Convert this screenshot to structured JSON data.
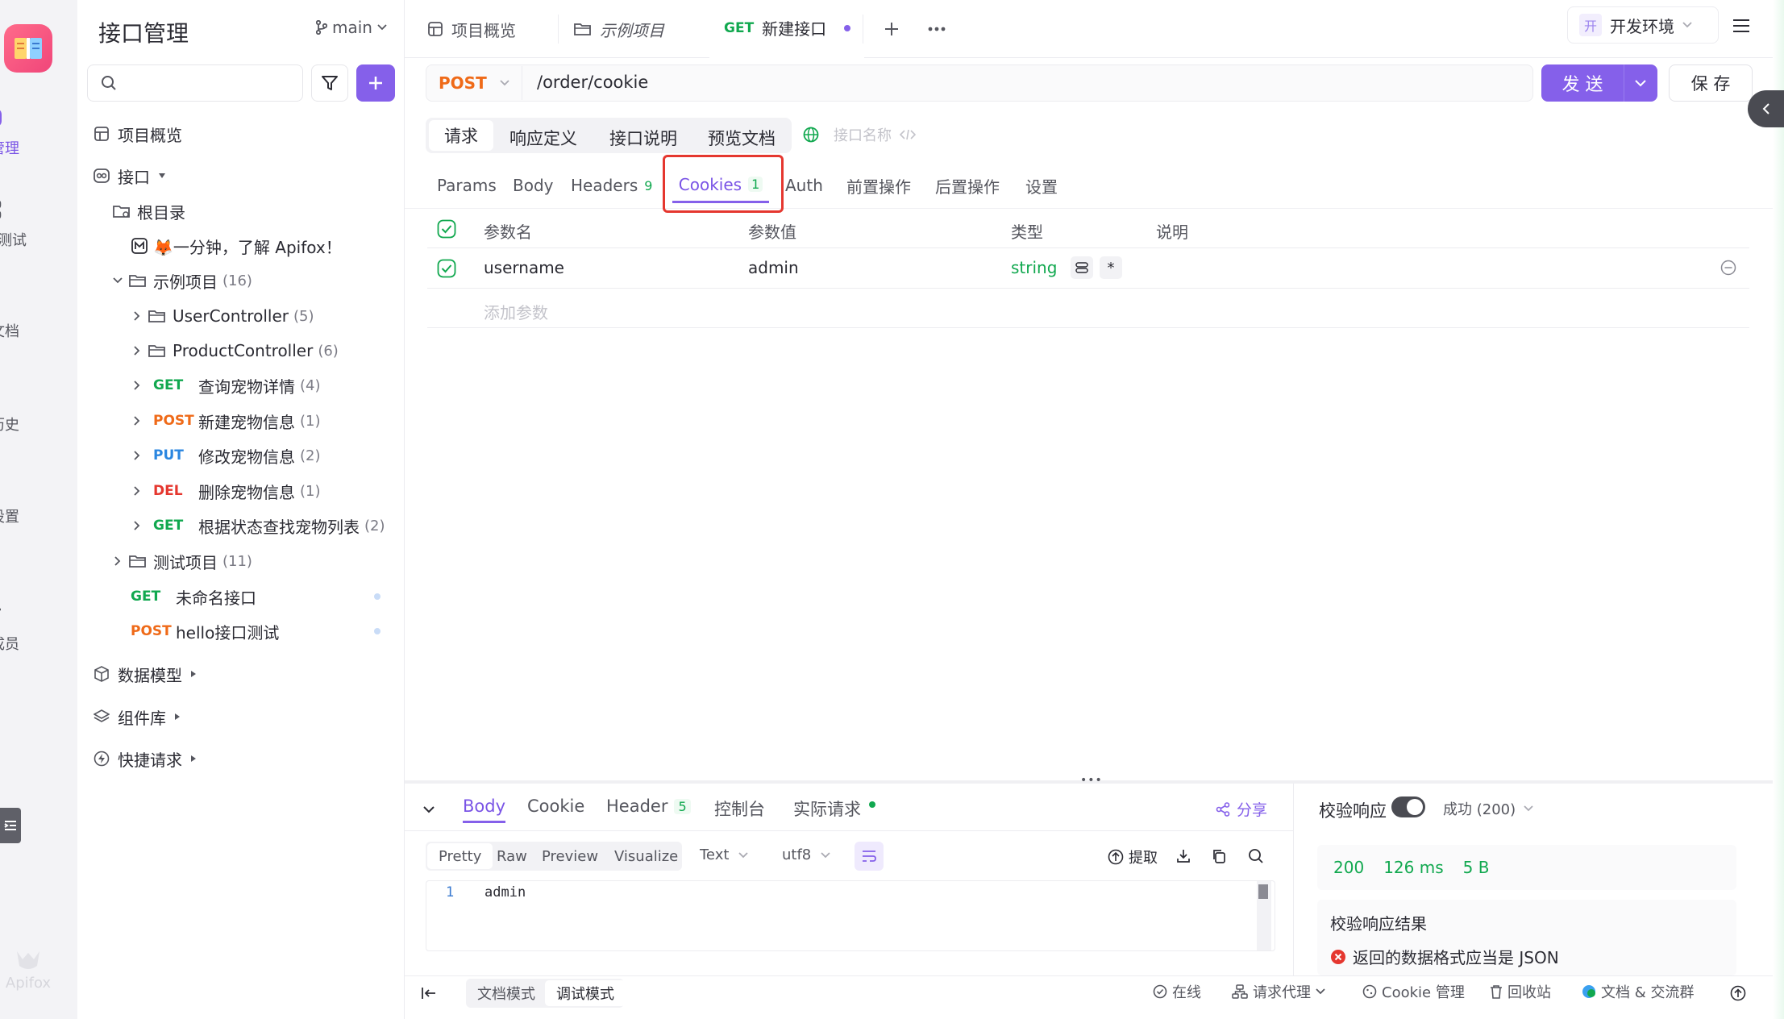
{
  "colors": {
    "accent": "#8560ea",
    "get": "#11a84f",
    "post": "#ef6a18",
    "put": "#2a86e0",
    "del": "#e5372f",
    "highlight": "#e5372f"
  },
  "rail": {
    "items": [
      {
        "label": "接口管理",
        "icon": "api-icon"
      },
      {
        "label": "自动化测试",
        "icon": "automation-icon"
      },
      {
        "label": "分享文档",
        "icon": "book-icon"
      },
      {
        "label": "请求历史",
        "icon": "clock-icon"
      },
      {
        "label": "项目设置",
        "icon": "gear-icon"
      },
      {
        "label": "邀请成员",
        "icon": "add-user-icon"
      }
    ],
    "brand": "Apifox"
  },
  "sidebar": {
    "title": "接口管理",
    "branch": "main",
    "search_placeholder": "",
    "overview": "项目概览",
    "api_section": "接口",
    "root": "根目录",
    "intro_doc": "🦊一分钟，了解 Apifox！",
    "folder_sample": {
      "name": "示例项目",
      "count": "(16)"
    },
    "tree": [
      {
        "kind": "folder",
        "name": "UserController",
        "count": "(5)"
      },
      {
        "kind": "folder",
        "name": "ProductController",
        "count": "(6)"
      },
      {
        "kind": "api",
        "method": "GET",
        "name": "查询宠物详情",
        "count": "(4)"
      },
      {
        "kind": "api",
        "method": "POST",
        "name": "新建宠物信息",
        "count": "(1)"
      },
      {
        "kind": "api",
        "method": "PUT",
        "name": "修改宠物信息",
        "count": "(2)"
      },
      {
        "kind": "api",
        "method": "DEL",
        "name": "删除宠物信息",
        "count": "(1)"
      },
      {
        "kind": "api",
        "method": "GET",
        "name": "根据状态查找宠物列表",
        "count": "(2)"
      }
    ],
    "folder_test": {
      "name": "测试项目",
      "count": "(11)"
    },
    "unsaved": [
      {
        "method": "GET",
        "name": "未命名接口"
      },
      {
        "method": "POST",
        "name": "hello接口测试"
      }
    ],
    "sections": [
      "数据模型",
      "组件库",
      "快捷请求"
    ]
  },
  "tabs": {
    "overview": "项目概览",
    "sample": "示例项目",
    "active_method": "GET",
    "active_name": "新建接口"
  },
  "env": {
    "badge": "开",
    "name": "开发环境"
  },
  "request": {
    "method": "POST",
    "url": "/order/cookie",
    "send": "发 送",
    "save": "保 存"
  },
  "mode_tabs": [
    "请求",
    "响应定义",
    "接口说明",
    "预览文档"
  ],
  "api_name_placeholder": "接口名称",
  "param_tabs": {
    "params": "Params",
    "body": "Body",
    "headers": "Headers",
    "headers_count": "9",
    "cookies": "Cookies",
    "cookies_count": "1",
    "auth": "Auth",
    "pre": "前置操作",
    "post": "后置操作",
    "settings": "设置"
  },
  "cookie_table": {
    "headers": [
      "参数名",
      "参数值",
      "类型",
      "说明"
    ],
    "rows": [
      {
        "name": "username",
        "value": "admin",
        "type": "string",
        "required": "*"
      }
    ],
    "add_placeholder": "添加参数"
  },
  "response": {
    "tabs": {
      "body": "Body",
      "cookie": "Cookie",
      "header": "Header",
      "header_count": "5",
      "console": "控制台",
      "actual": "实际请求"
    },
    "share": "分享",
    "views": [
      "Pretty",
      "Raw",
      "Preview",
      "Visualize"
    ],
    "format": "Text",
    "encoding": "utf8",
    "extract": "提取",
    "code_line": "1",
    "code_text": "admin"
  },
  "validation": {
    "label": "校验响应",
    "status": "成功 (200)",
    "metrics": {
      "code": "200",
      "time": "126 ms",
      "size": "5 B"
    },
    "result_title": "校验响应结果",
    "error": "返回的数据格式应当是 JSON"
  },
  "footer": {
    "doc_mode": "文档模式",
    "debug_mode": "调试模式",
    "online": "在线",
    "proxy": "请求代理",
    "cookie_mgmt": "Cookie 管理",
    "recycle": "回收站",
    "docs_group": "文档 & 交流群"
  }
}
